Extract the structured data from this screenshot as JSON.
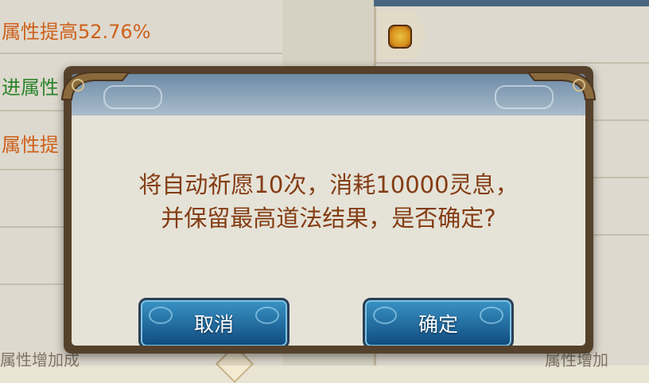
{
  "background": {
    "left_rows": [
      {
        "text": "属性提高52.76%",
        "color": "orange"
      },
      {
        "text": "进属性",
        "color": "green"
      },
      {
        "text": "属性提",
        "color": "orange"
      },
      {
        "text": "",
        "color": "orange"
      },
      {
        "text": "",
        "color": "orange"
      }
    ],
    "bottom_left_text": "属性增加成",
    "bottom_right_text": "属性增加"
  },
  "dialog": {
    "message_line1": "将自动祈愿10次，消耗10000灵息，",
    "message_line2": "并保留最高道法结果，是否确定?",
    "cancel_label": "取消",
    "confirm_label": "确定"
  },
  "colors": {
    "message_text": "#843c13",
    "button_fill": "#1f6ea3",
    "dialog_frame": "#55412b",
    "header_blue": "#6d8ba7"
  }
}
